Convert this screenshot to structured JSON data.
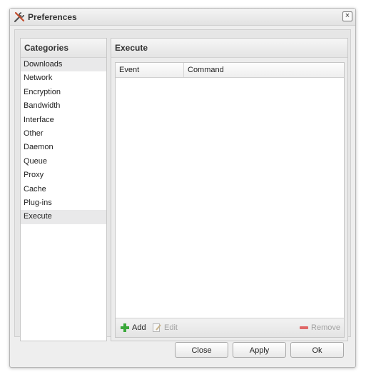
{
  "window": {
    "title": "Preferences",
    "icon": "tools-icon"
  },
  "categories": {
    "header": "Categories",
    "items": [
      "Downloads",
      "Network",
      "Encryption",
      "Bandwidth",
      "Interface",
      "Other",
      "Daemon",
      "Queue",
      "Proxy",
      "Cache",
      "Plug-ins",
      "Execute"
    ],
    "selected": "Execute"
  },
  "execute": {
    "header": "Execute",
    "columns": [
      "Event",
      "Command"
    ],
    "rows": [],
    "toolbar": {
      "add": "Add",
      "edit": "Edit",
      "remove": "Remove"
    }
  },
  "footer": {
    "close": "Close",
    "apply": "Apply",
    "ok": "Ok"
  },
  "colors": {
    "add_green": "#3aa83a",
    "remove_red": "#e06767",
    "disabled_text": "#a3a3a3"
  }
}
